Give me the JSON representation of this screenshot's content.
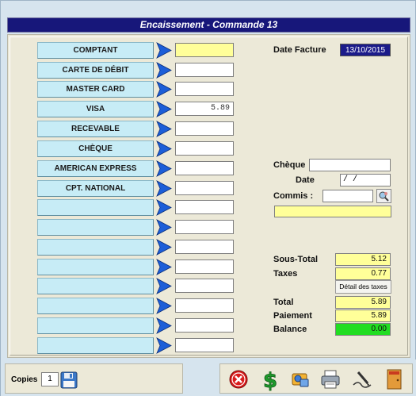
{
  "window": {
    "title": "Encaissement - Commande 13"
  },
  "payments": [
    {
      "label": "COMPTANT",
      "value": ""
    },
    {
      "label": "CARTE DE DÉBIT",
      "value": ""
    },
    {
      "label": "MASTER CARD",
      "value": ""
    },
    {
      "label": "VISA",
      "value": "5.89"
    },
    {
      "label": "RECEVABLE",
      "value": ""
    },
    {
      "label": "CHÈQUE",
      "value": ""
    },
    {
      "label": "AMERICAN EXPRESS",
      "value": ""
    },
    {
      "label": "CPT. NATIONAL",
      "value": ""
    },
    {
      "label": "",
      "value": ""
    },
    {
      "label": "",
      "value": ""
    },
    {
      "label": "",
      "value": ""
    },
    {
      "label": "",
      "value": ""
    },
    {
      "label": "",
      "value": ""
    },
    {
      "label": "",
      "value": ""
    },
    {
      "label": "",
      "value": ""
    },
    {
      "label": "",
      "value": ""
    }
  ],
  "invoice": {
    "date_label": "Date Facture",
    "date_value": "13/10/2015"
  },
  "cheque": {
    "cheque_label": "Chèque",
    "cheque_value": "",
    "date_label": "Date",
    "date_value": " / /",
    "commis_label": "Commis :",
    "commis_value": "",
    "commis_name": ""
  },
  "totals": {
    "subtotal_label": "Sous-Total",
    "subtotal_value": "5.12",
    "taxes_label": "Taxes",
    "taxes_value": "0.77",
    "detail_taxes_label": "Détail des taxes",
    "total_label": "Total",
    "total_value": "5.89",
    "payment_label": "Paiement",
    "payment_value": "5.89",
    "balance_label": "Balance",
    "balance_value": "0.00"
  },
  "footer": {
    "copies_label": "Copies",
    "copies_value": "1",
    "icons": [
      "save-icon",
      "cancel-icon",
      "dollar-icon",
      "payment-card-icon",
      "printer-icon",
      "signature-icon",
      "exit-door-icon"
    ]
  },
  "colors": {
    "title_bg": "#17177a",
    "button_bg": "#c7ecf6",
    "yellow_field": "#ffff99",
    "balance_green": "#22dd22",
    "date_bg": "#1b1b8a"
  }
}
